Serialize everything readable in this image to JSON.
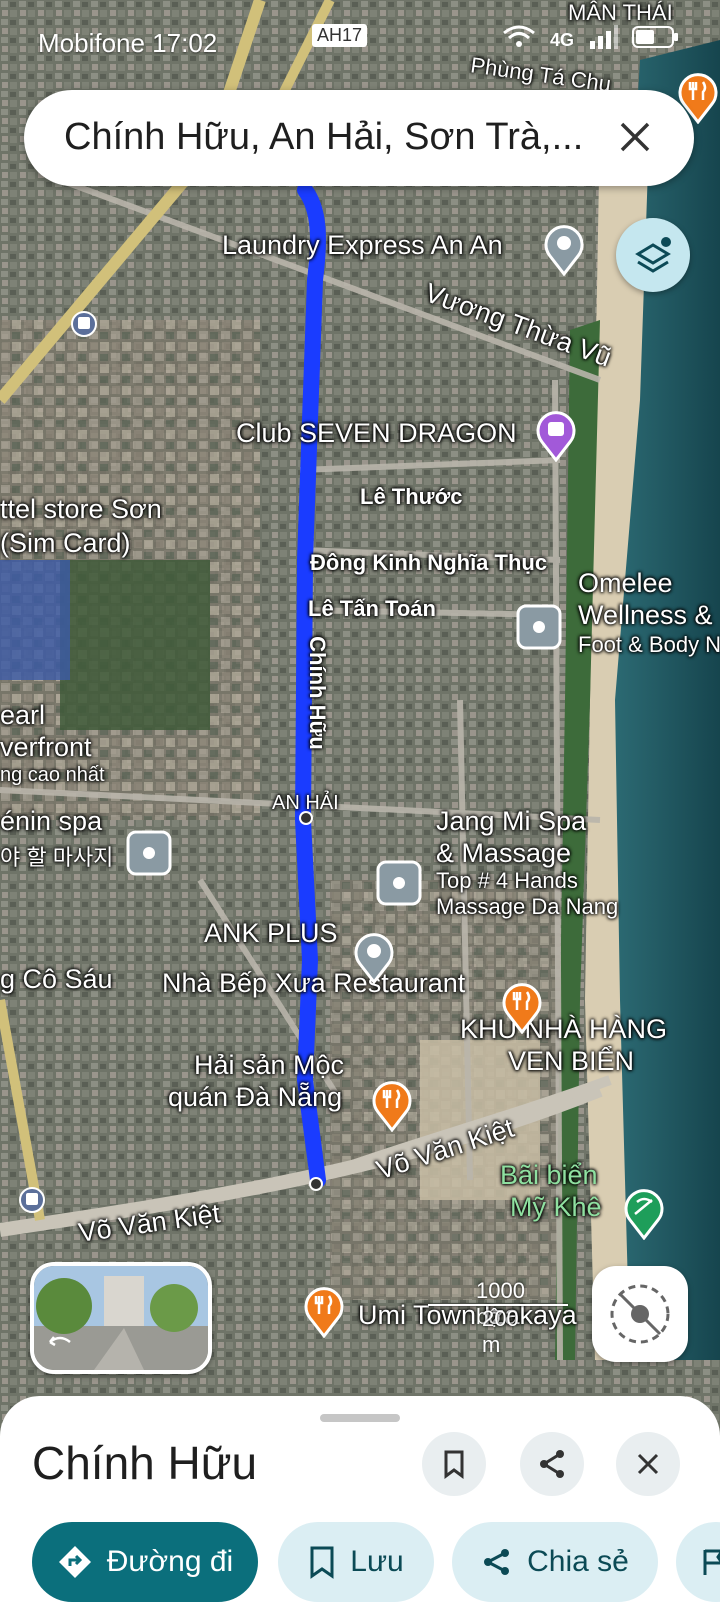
{
  "status_bar": {
    "carrier": "Mobifone 17:02",
    "network": "4G",
    "battery": "battery-icon"
  },
  "search": {
    "query": "Chính Hữu, An Hải, Sơn Trà,..."
  },
  "map": {
    "road_labels": {
      "phung_ta_chu": "Phùng Tá Chu",
      "vuong_thua_vu": "Vương Thừa Vũ",
      "le_thuoc": "Lê Thước",
      "dong_kinh_nghia_thuc": "Đông Kinh Nghĩa Thục",
      "le_tan_toan": "Lê Tấn Toán",
      "chinh_huu": "Chính Hữu",
      "vo_van_kiet_1": "Võ Văn Kiệt",
      "vo_van_kiet_2": "Võ Văn Kiệt",
      "highway": "AH17",
      "area": "AN HẢI"
    },
    "poi_labels": {
      "laundry": "Laundry Express An An",
      "club": "Club SEVEN DRAGON",
      "viettel_1": "ttel store Sơn",
      "viettel_2": "(Sim Card)",
      "omelee_1": "Omelee",
      "omelee_2": "Wellness &",
      "omelee_3": "Foot & Body N",
      "pearl_1": "earl",
      "pearl_2": "verfront",
      "pearl_3": "ng cao nhất",
      "lenin_1": "énin spa",
      "lenin_2": "야 할 마사지",
      "jangmi_1": "Jang Mi Spa",
      "jangmi_2": "& Massage",
      "jangmi_3": "Top # 4 Hands",
      "jangmi_4": "Massage Da Nang",
      "ank": "ANK PLUS",
      "nha_bep": "Nhà Bếp Xưa Restaurant",
      "khu_1": "KHU NHÀ HÀNG",
      "khu_2": "VEN BIỂN",
      "hai_san_1": "Hải sản Mộc",
      "hai_san_2": "quán Đà Nẵng",
      "co_sau": "g Cô Sáu",
      "bai_bien_1": "Bãi biển",
      "bai_bien_2": "Mỹ Khê",
      "umi": "Umi Town Izakaya",
      "man_thai": "MÂN THÁI"
    },
    "scale": {
      "feet": "1000 bộ",
      "meters": "200 m"
    },
    "colors": {
      "route": "#1a3cff",
      "food": "#f07a1a",
      "nightlife": "#a259d9",
      "beach": "#1e9e5a",
      "generic": "#8a9aa3"
    }
  },
  "sheet": {
    "title": "Chính Hữu",
    "actions": {
      "directions": "Đường đi",
      "save": "Lưu",
      "share": "Chia sẻ"
    }
  }
}
